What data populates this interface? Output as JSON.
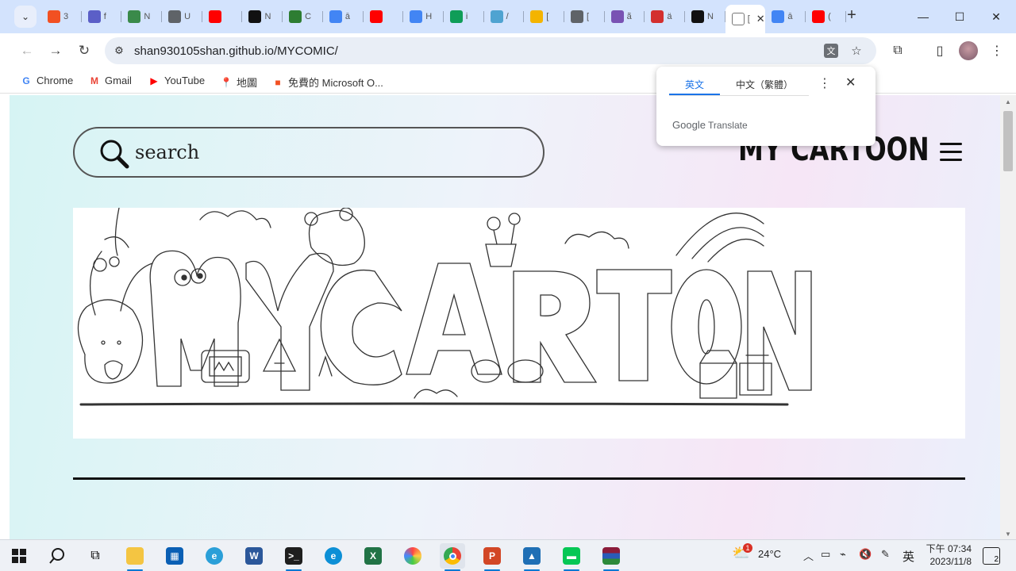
{
  "tabstrip": {
    "tabs": [
      {
        "letter": "3",
        "icon": "microsoft-icon",
        "color": "#f25022"
      },
      {
        "letter": "f",
        "icon": "teams-icon",
        "color": "#5b5fc7"
      },
      {
        "letter": "N",
        "icon": "avatar-app-icon",
        "color": "#3a8a4a"
      },
      {
        "letter": "U",
        "icon": "globe-icon",
        "color": "#5f6368"
      },
      {
        "letter": "",
        "icon": "youtube-icon",
        "color": "#ff0000"
      },
      {
        "letter": "N",
        "icon": "codepen-icon",
        "color": "#111111"
      },
      {
        "letter": "C",
        "icon": "w-icon",
        "color": "#2e7d32"
      },
      {
        "letter": "ā",
        "icon": "google-icon",
        "color": "#4285f4"
      },
      {
        "letter": "",
        "icon": "youtube-icon",
        "color": "#ff0000"
      },
      {
        "letter": "H",
        "icon": "google-icon",
        "color": "#4285f4"
      },
      {
        "letter": "i",
        "icon": "drive-icon",
        "color": "#0f9d58"
      },
      {
        "letter": "/",
        "icon": "cloud-icon",
        "color": "#4fa3d1"
      },
      {
        "letter": "[",
        "icon": "m-icon",
        "color": "#f4b400"
      },
      {
        "letter": "[",
        "icon": "globe-icon",
        "color": "#5f6368"
      },
      {
        "letter": "ã",
        "icon": "bootstrap-icon",
        "color": "#7952b3"
      },
      {
        "letter": "ä",
        "icon": "acrobat-icon",
        "color": "#d32f2f"
      },
      {
        "letter": "N",
        "icon": "github-icon",
        "color": "#111111"
      },
      {
        "letter": "[",
        "icon": "tab-active-icon",
        "color": "#ffffff",
        "active": true
      },
      {
        "letter": "ā",
        "icon": "google-icon",
        "color": "#4285f4"
      },
      {
        "letter": "(",
        "icon": "youtube-icon",
        "color": "#ff0000"
      }
    ],
    "new_tab": "+"
  },
  "toolbar": {
    "url": "shan930105shan.github.io/MYCOMIC/"
  },
  "bookmarks": [
    {
      "label": "Chrome",
      "icon": "google-icon",
      "color": "#4285f4",
      "glyph": "G"
    },
    {
      "label": "Gmail",
      "icon": "gmail-icon",
      "color": "#ea4335",
      "glyph": "M"
    },
    {
      "label": "YouTube",
      "icon": "youtube-icon",
      "color": "#ff0000",
      "glyph": "▶"
    },
    {
      "label": "地圖",
      "icon": "maps-icon",
      "color": "#34a853",
      "glyph": "📍"
    },
    {
      "label": "免費的 Microsoft O...",
      "icon": "microsoft-icon",
      "color": "#f25022",
      "glyph": "■"
    }
  ],
  "page": {
    "search_placeholder": "search",
    "site_title": "MY CARTOON",
    "banner_alt": "MY CARTOON"
  },
  "translate_popup": {
    "tab_source": "英文",
    "tab_target": "中文（繁體）",
    "brand_google": "Google",
    "brand_translate": "Translate",
    "accent": "#1a73e8"
  },
  "taskbar": {
    "weather_temp": "24°C",
    "weather_badge": "1",
    "ime": "英",
    "time": "下午 07:34",
    "date": "2023/11/8",
    "notifications": "2"
  }
}
